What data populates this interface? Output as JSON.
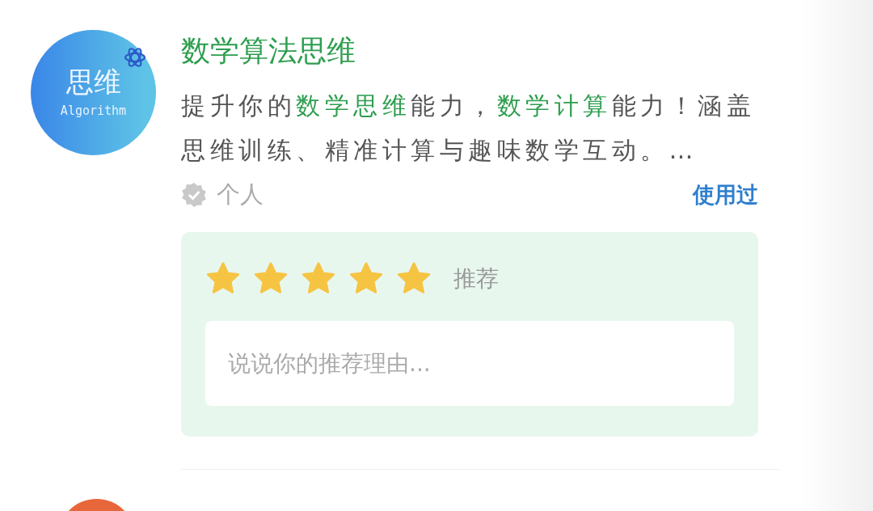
{
  "apps": [
    {
      "avatar": {
        "title": "思维",
        "subtitle": "Algorithm"
      },
      "name": "数学算法思维",
      "description": "提升你的**数学思维**能力，**数学计算**能力！涵盖思维训练、精准计算与趣味数学互动。…",
      "owner": "个人",
      "verified": true,
      "status": "使用过",
      "review": {
        "stars": 5,
        "label": "推荐",
        "placeholder": "说说你的推荐理由..."
      }
    }
  ]
}
